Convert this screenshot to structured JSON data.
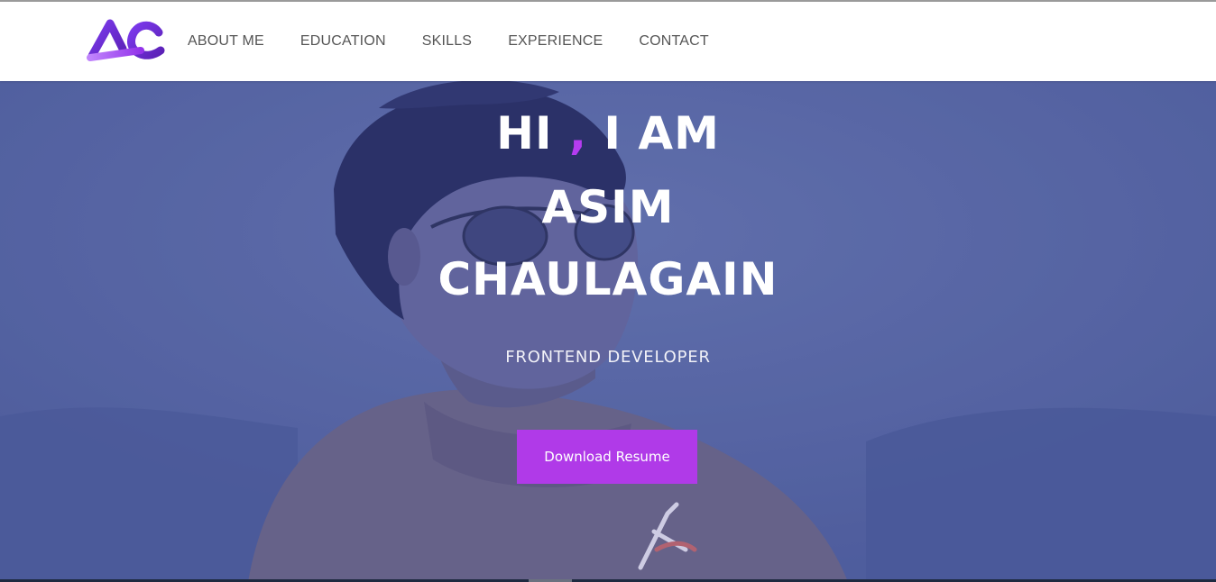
{
  "brand": {
    "logo_text": "AC",
    "colors": {
      "logo_light": "#a855f7",
      "logo_dark": "#6d28d9"
    }
  },
  "nav": {
    "items": [
      {
        "label": "ABOUT ME"
      },
      {
        "label": "EDUCATION"
      },
      {
        "label": "SKILLS"
      },
      {
        "label": "EXPERIENCE"
      },
      {
        "label": "CONTACT"
      }
    ]
  },
  "hero": {
    "greeting_start": "HI ",
    "greeting_comma": ",",
    "greeting_end": " I AM",
    "first_name": "ASIM",
    "last_name": "CHAULAGAIN",
    "subtitle": "FRONTEND DEVELOPER",
    "cta_label": "Download Resume",
    "colors": {
      "accent": "#b03ae8",
      "overlay": "#5b67a0"
    }
  }
}
